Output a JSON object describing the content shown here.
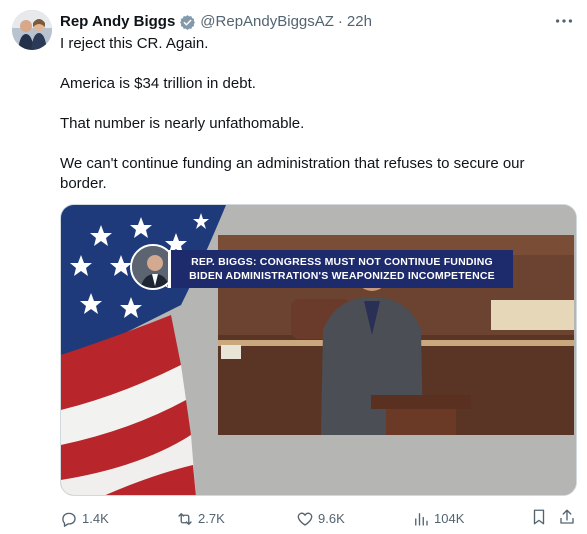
{
  "author": {
    "display_name": "Rep Andy Biggs",
    "handle": "@RepAndyBiggsAZ",
    "separator": "·",
    "time": "22h",
    "verified_icon": "verified-badge-icon"
  },
  "tweet": {
    "paragraphs": [
      "I reject this CR. Again.",
      "America is $34 trillion in debt.",
      "That number is nearly unfathomable.",
      "We can't continue funding an administration that refuses to secure our border."
    ]
  },
  "media": {
    "chyron_line1": "REP. BIGGS: CONGRESS MUST NOT CONTINUE FUNDING",
    "chyron_line2": "BIDEN ADMINISTRATION'S WEAPONIZED INCOMPETENCE",
    "chyron_color": "#1d2a6b"
  },
  "actions": {
    "replies": "1.4K",
    "reposts": "2.7K",
    "likes": "9.6K",
    "views": "104K",
    "icons": [
      "reply-icon",
      "repost-icon",
      "like-icon",
      "views-icon",
      "bookmark-icon",
      "share-icon"
    ]
  },
  "colors": {
    "text": "#0f1419",
    "muted": "#536471",
    "verified": "#829aab"
  }
}
